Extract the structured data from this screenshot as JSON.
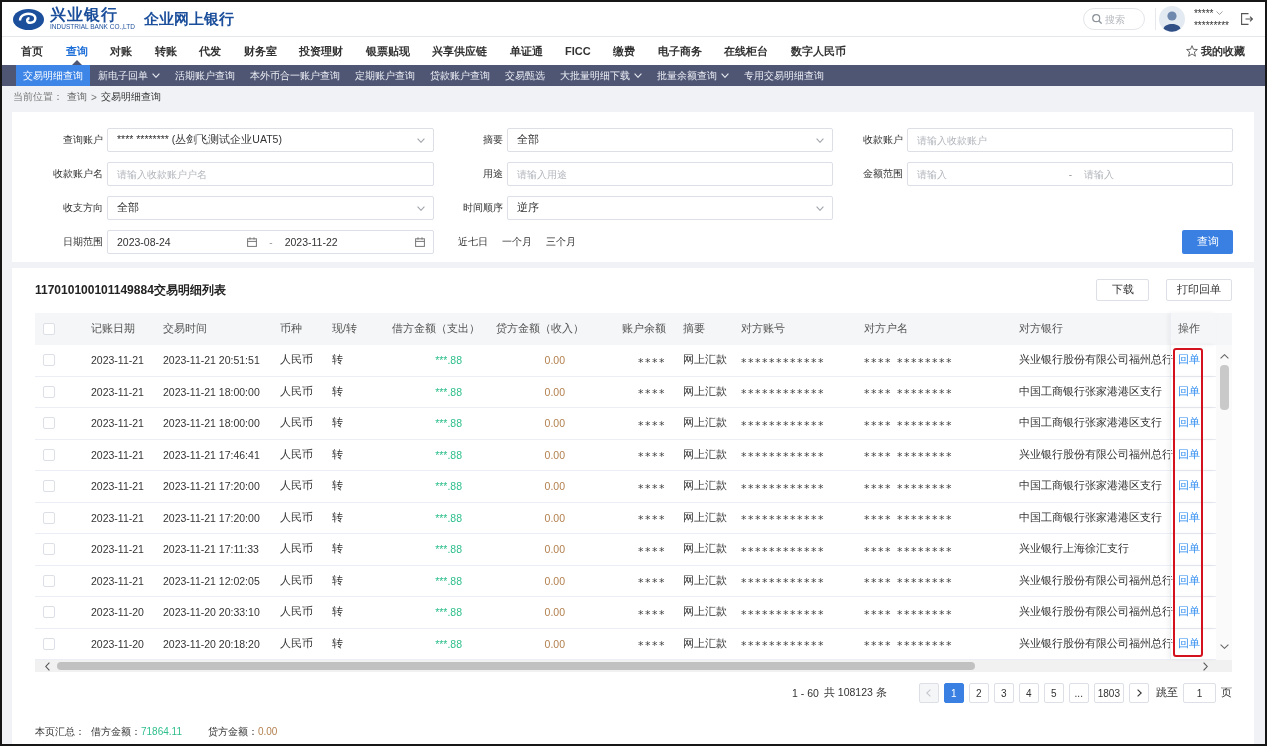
{
  "header": {
    "logo": {
      "name": "兴业银行",
      "subtitle": "INDUSTRIAL BANK CO.,LTD",
      "product": "企业网上银行"
    },
    "search": {
      "placeholder": "搜索"
    },
    "user": {
      "name": "*****",
      "account": "*********"
    }
  },
  "main_nav": [
    {
      "label": "首页",
      "selected": false
    },
    {
      "label": "查询",
      "selected": true
    },
    {
      "label": "对账",
      "selected": false
    },
    {
      "label": "转账",
      "selected": false
    },
    {
      "label": "代发",
      "selected": false
    },
    {
      "label": "财务室",
      "selected": false
    },
    {
      "label": "投资理财",
      "selected": false
    },
    {
      "label": "银票贴现",
      "selected": false
    },
    {
      "label": "兴享供应链",
      "selected": false
    },
    {
      "label": "单证通",
      "selected": false
    },
    {
      "label": "FICC",
      "selected": false
    },
    {
      "label": "缴费",
      "selected": false
    },
    {
      "label": "电子商务",
      "selected": false
    },
    {
      "label": "在线柜台",
      "selected": false
    },
    {
      "label": "数字人民币",
      "selected": false
    }
  ],
  "favorites": {
    "label": "我的收藏"
  },
  "sub_nav": [
    {
      "label": "交易明细查询",
      "selected": true,
      "dropdown": false
    },
    {
      "label": "新电子回单",
      "selected": false,
      "dropdown": true
    },
    {
      "label": "活期账户查询",
      "selected": false,
      "dropdown": false
    },
    {
      "label": "本外币合一账户查询",
      "selected": false,
      "dropdown": false
    },
    {
      "label": "定期账户查询",
      "selected": false,
      "dropdown": false
    },
    {
      "label": "贷款账户查询",
      "selected": false,
      "dropdown": false
    },
    {
      "label": "交易甄选",
      "selected": false,
      "dropdown": false
    },
    {
      "label": "大批量明细下载",
      "selected": false,
      "dropdown": true
    },
    {
      "label": "批量余额查询",
      "selected": false,
      "dropdown": true
    },
    {
      "label": "专用交易明细查询",
      "selected": false,
      "dropdown": false
    }
  ],
  "breadcrumb": {
    "label": "当前位置：",
    "items": [
      "查询",
      "交易明细查询"
    ],
    "separator": ">"
  },
  "filter_rows": [
    [
      {
        "label": "查询账户",
        "kind": "select",
        "value": "**** ******** (丛剑飞测试企业UAT5)"
      },
      {
        "label": "摘要",
        "kind": "select",
        "value": "全部"
      },
      {
        "label": "收款账户",
        "kind": "input",
        "placeholder": "请输入收款账户"
      }
    ],
    [
      {
        "label": "收款账户名",
        "kind": "input",
        "placeholder": "请输入收款账户户名"
      },
      {
        "label": "用途",
        "kind": "input",
        "placeholder": "请输入用途"
      },
      {
        "label": "金额范围",
        "kind": "range",
        "from_placeholder": "请输入",
        "separator": "-",
        "to_placeholder": "请输入"
      }
    ],
    [
      {
        "label": "收支方向",
        "kind": "select",
        "value": "全部"
      },
      {
        "label": "时间顺序",
        "kind": "select",
        "value": "逆序"
      }
    ],
    [
      {
        "label": "日期范围",
        "kind": "date_range",
        "from": "2023-08-24",
        "separator": "-",
        "to": "2023-11-22"
      }
    ]
  ],
  "quick_ranges": [
    "近七日",
    "一个月",
    "三个月"
  ],
  "submit": "查询",
  "table": {
    "title": "117010100101149884交易明细列表",
    "actions": [
      "下载",
      "打印回单"
    ],
    "select_all": {
      "checked": false
    },
    "operation_column_highlighted": true,
    "columns": [
      {
        "label": "记账日期",
        "kind": "text"
      },
      {
        "label": "交易时间",
        "kind": "text"
      },
      {
        "label": "币种",
        "kind": "text"
      },
      {
        "label": "现/转",
        "kind": "text"
      },
      {
        "label": "借方金额（支出）",
        "kind": "debit"
      },
      {
        "label": "贷方金额（收入）",
        "kind": "credit"
      },
      {
        "label": "账户余额",
        "kind": "balance"
      },
      {
        "label": "摘要",
        "kind": "text"
      },
      {
        "label": "对方账号",
        "kind": "masked"
      },
      {
        "label": "对方户名",
        "kind": "masked"
      },
      {
        "label": "对方银行",
        "kind": "text"
      },
      {
        "label": "操作",
        "kind": "link"
      }
    ],
    "rows": [
      {
        "checked": false,
        "cells": [
          "2023-11-21",
          "2023-11-21 20:51:51",
          "人民币",
          "转",
          "***.88",
          "0.00",
          "****",
          "网上汇款",
          "************",
          "**** ********",
          "兴业银行股份有限公司福州总行",
          "回单"
        ]
      },
      {
        "checked": false,
        "cells": [
          "2023-11-21",
          "2023-11-21 18:00:00",
          "人民币",
          "转",
          "***.88",
          "0.00",
          "****",
          "网上汇款",
          "************",
          "**** ********",
          "中国工商银行张家港港区支行",
          "回单"
        ]
      },
      {
        "checked": false,
        "cells": [
          "2023-11-21",
          "2023-11-21 18:00:00",
          "人民币",
          "转",
          "***.88",
          "0.00",
          "****",
          "网上汇款",
          "************",
          "**** ********",
          "中国工商银行张家港港区支行",
          "回单"
        ]
      },
      {
        "checked": false,
        "cells": [
          "2023-11-21",
          "2023-11-21 17:46:41",
          "人民币",
          "转",
          "***.88",
          "0.00",
          "****",
          "网上汇款",
          "************",
          "**** ********",
          "兴业银行股份有限公司福州总行",
          "回单"
        ]
      },
      {
        "checked": false,
        "cells": [
          "2023-11-21",
          "2023-11-21 17:20:00",
          "人民币",
          "转",
          "***.88",
          "0.00",
          "****",
          "网上汇款",
          "************",
          "**** ********",
          "中国工商银行张家港港区支行",
          "回单"
        ]
      },
      {
        "checked": false,
        "cells": [
          "2023-11-21",
          "2023-11-21 17:20:00",
          "人民币",
          "转",
          "***.88",
          "0.00",
          "****",
          "网上汇款",
          "************",
          "**** ********",
          "中国工商银行张家港港区支行",
          "回单"
        ]
      },
      {
        "checked": false,
        "cells": [
          "2023-11-21",
          "2023-11-21 17:11:33",
          "人民币",
          "转",
          "***.88",
          "0.00",
          "****",
          "网上汇款",
          "************",
          "**** ********",
          "兴业银行上海徐汇支行",
          "回单"
        ]
      },
      {
        "checked": false,
        "cells": [
          "2023-11-21",
          "2023-11-21 12:02:05",
          "人民币",
          "转",
          "***.88",
          "0.00",
          "****",
          "网上汇款",
          "************",
          "**** ********",
          "兴业银行股份有限公司福州总行",
          "回单"
        ]
      },
      {
        "checked": false,
        "cells": [
          "2023-11-20",
          "2023-11-20 20:33:10",
          "人民币",
          "转",
          "***.88",
          "0.00",
          "****",
          "网上汇款",
          "************",
          "**** ********",
          "兴业银行股份有限公司福州总行",
          "回单"
        ]
      },
      {
        "checked": false,
        "cells": [
          "2023-11-20",
          "2023-11-20 20:18:20",
          "人民币",
          "转",
          "***.88",
          "0.00",
          "****",
          "网上汇款",
          "************",
          "**** ********",
          "兴业银行股份有限公司福州总行",
          "回单"
        ]
      }
    ]
  },
  "pagination": {
    "range": "1 - 60",
    "total": "共 108123 条",
    "prev": {
      "disabled": true
    },
    "next": {
      "disabled": false
    },
    "pages": [
      {
        "label": "1",
        "selected": true
      },
      {
        "label": "2",
        "selected": false
      },
      {
        "label": "3",
        "selected": false
      },
      {
        "label": "4",
        "selected": false
      },
      {
        "label": "5",
        "selected": false
      },
      {
        "label": "...",
        "selected": false
      },
      {
        "label": "1803",
        "selected": false
      }
    ],
    "jump_label": "跳至",
    "jump_value": "1",
    "page_unit": "页"
  },
  "summary": {
    "label": "本页汇总：",
    "items": [
      {
        "label": "借方金额：",
        "value": "71864.11",
        "kind": "debit"
      },
      {
        "label": "贷方金额：",
        "value": "0.00",
        "kind": "credit"
      }
    ]
  }
}
